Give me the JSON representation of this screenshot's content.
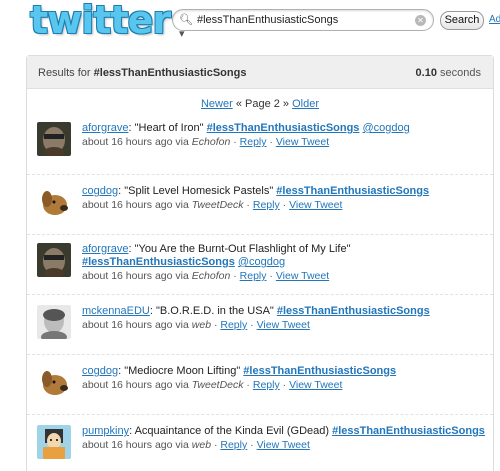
{
  "header": {
    "logo_text": "twitter",
    "search_value": "#lessThanEnthusiasticSongs",
    "search_button": "Search",
    "advanced_link": "Ad"
  },
  "results": {
    "label_prefix": "Results for",
    "query": "#lessThanEnthusiasticSongs",
    "time_value": "0.10",
    "time_unit": "seconds"
  },
  "pager": {
    "newer": "Newer",
    "middle": "« Page 2 »",
    "older": "Older"
  },
  "tweets": [
    {
      "user": "aforgrave",
      "text": ": \"Heart of Iron\" ",
      "hashtag": "#lessThanEnthusiasticSongs",
      "mention": "@cogdog",
      "time": "about 16 hours ago via",
      "source": "Echofon",
      "reply": "Reply",
      "view": "View Tweet"
    },
    {
      "user": "cogdog",
      "text": ": \"Split Level Homesick Pastels\" ",
      "hashtag": "#lessThanEnthusiasticSongs",
      "mention": "",
      "time": "about 16 hours ago via",
      "source": "TweetDeck",
      "reply": "Reply",
      "view": "View Tweet"
    },
    {
      "user": "aforgrave",
      "text": ": \"You Are the Burnt-Out Flashlight of My Life\"",
      "hashtag": "#lessThanEnthusiasticSongs",
      "mention": "@cogdog",
      "time": "about 16 hours ago via",
      "source": "Echofon",
      "reply": "Reply",
      "view": "View Tweet"
    },
    {
      "user": "mckennaEDU",
      "text": ": \"B.O.R.E.D. in the USA\" ",
      "hashtag": "#lessThanEnthusiasticSongs",
      "mention": "",
      "time": "about 16 hours ago via",
      "source": "web",
      "reply": "Reply",
      "view": "View Tweet"
    },
    {
      "user": "cogdog",
      "text": ": \"Mediocre Moon Lifting\" ",
      "hashtag": "#lessThanEnthusiasticSongs",
      "mention": "",
      "time": "about 16 hours ago via",
      "source": "TweetDeck",
      "reply": "Reply",
      "view": "View Tweet"
    },
    {
      "user": "pumpkiny",
      "text": ": Acquaintance of the Kinda Evil (GDead) ",
      "hashtag": "#lessThanEnthusiasticSongs",
      "mention": "",
      "time": "about 16 hours ago via",
      "source": "web",
      "reply": "Reply",
      "view": "View Tweet"
    }
  ],
  "colors": {
    "link": "#2276bb",
    "logo": "#59c6ef",
    "panel_header": "#efefef"
  }
}
